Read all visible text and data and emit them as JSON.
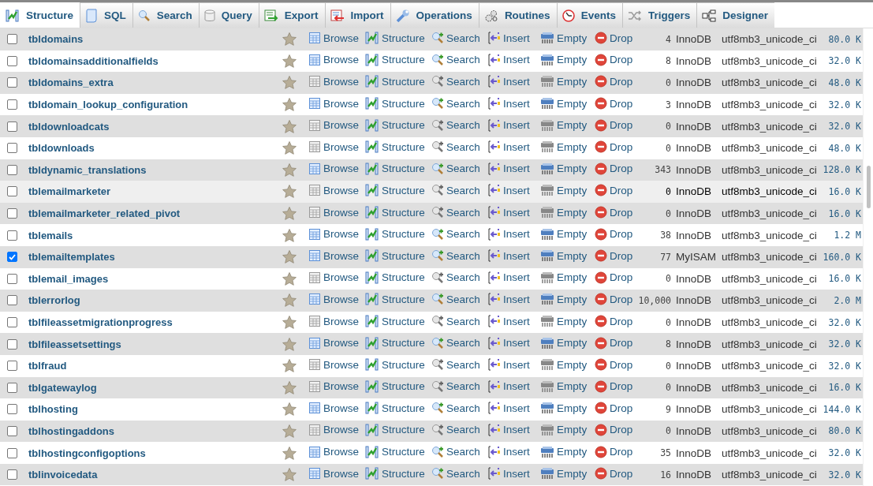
{
  "tabs": [
    {
      "label": "Structure",
      "selected": true
    },
    {
      "label": "SQL",
      "selected": false
    },
    {
      "label": "Search",
      "selected": false
    },
    {
      "label": "Query",
      "selected": false
    },
    {
      "label": "Export",
      "selected": false
    },
    {
      "label": "Import",
      "selected": false
    },
    {
      "label": "Operations",
      "selected": false
    },
    {
      "label": "Routines",
      "selected": false
    },
    {
      "label": "Events",
      "selected": false
    },
    {
      "label": "Triggers",
      "selected": false
    },
    {
      "label": "Designer",
      "selected": false
    }
  ],
  "rows": [
    {
      "name": "tbldomains",
      "checked": false,
      "hovered": false,
      "empty": false,
      "actions": [
        "Browse",
        "Structure",
        "Search",
        "Insert",
        "Empty",
        "Drop"
      ],
      "rows": "4",
      "engine": "InnoDB",
      "collation": "utf8mb3_unicode_ci",
      "size": "80.0 K"
    },
    {
      "name": "tbldomainsadditionalfields",
      "checked": false,
      "hovered": false,
      "empty": false,
      "actions": [
        "Browse",
        "Structure",
        "Search",
        "Insert",
        "Empty",
        "Drop"
      ],
      "rows": "8",
      "engine": "InnoDB",
      "collation": "utf8mb3_unicode_ci",
      "size": "32.0 K"
    },
    {
      "name": "tbldomains_extra",
      "checked": false,
      "hovered": false,
      "empty": true,
      "actions": [
        "Browse",
        "Structure",
        "Search",
        "Insert",
        "Empty",
        "Drop"
      ],
      "rows": "0",
      "engine": "InnoDB",
      "collation": "utf8mb3_unicode_ci",
      "size": "48.0 K"
    },
    {
      "name": "tbldomain_lookup_configuration",
      "checked": false,
      "hovered": false,
      "empty": false,
      "actions": [
        "Browse",
        "Structure",
        "Search",
        "Insert",
        "Empty",
        "Drop"
      ],
      "rows": "3",
      "engine": "InnoDB",
      "collation": "utf8mb3_unicode_ci",
      "size": "32.0 K"
    },
    {
      "name": "tbldownloadcats",
      "checked": false,
      "hovered": false,
      "empty": true,
      "actions": [
        "Browse",
        "Structure",
        "Search",
        "Insert",
        "Empty",
        "Drop"
      ],
      "rows": "0",
      "engine": "InnoDB",
      "collation": "utf8mb3_unicode_ci",
      "size": "32.0 K"
    },
    {
      "name": "tbldownloads",
      "checked": false,
      "hovered": false,
      "empty": true,
      "actions": [
        "Browse",
        "Structure",
        "Search",
        "Insert",
        "Empty",
        "Drop"
      ],
      "rows": "0",
      "engine": "InnoDB",
      "collation": "utf8mb3_unicode_ci",
      "size": "48.0 K"
    },
    {
      "name": "tbldynamic_translations",
      "checked": false,
      "hovered": false,
      "empty": false,
      "actions": [
        "Browse",
        "Structure",
        "Search",
        "Insert",
        "Empty",
        "Drop"
      ],
      "rows": "343",
      "engine": "InnoDB",
      "collation": "utf8mb3_unicode_ci",
      "size": "128.0 K"
    },
    {
      "name": "tblemailmarketer",
      "checked": false,
      "hovered": true,
      "empty": true,
      "actions": [
        "Browse",
        "Structure",
        "Search",
        "Insert",
        "Empty",
        "Drop"
      ],
      "rows": "0",
      "engine": "InnoDB",
      "collation": "utf8mb3_unicode_ci",
      "size": "16.0 K"
    },
    {
      "name": "tblemailmarketer_related_pivot",
      "checked": false,
      "hovered": false,
      "empty": true,
      "actions": [
        "Browse",
        "Structure",
        "Search",
        "Insert",
        "Empty",
        "Drop"
      ],
      "rows": "0",
      "engine": "InnoDB",
      "collation": "utf8mb3_unicode_ci",
      "size": "16.0 K"
    },
    {
      "name": "tblemails",
      "checked": false,
      "hovered": false,
      "empty": false,
      "actions": [
        "Browse",
        "Structure",
        "Search",
        "Insert",
        "Empty",
        "Drop"
      ],
      "rows": "38",
      "engine": "InnoDB",
      "collation": "utf8mb3_unicode_ci",
      "size": "1.2 M"
    },
    {
      "name": "tblemailtemplates",
      "checked": true,
      "hovered": false,
      "empty": false,
      "actions": [
        "Browse",
        "Structure",
        "Search",
        "Insert",
        "Empty",
        "Drop"
      ],
      "rows": "77",
      "engine": "MyISAM",
      "collation": "utf8mb3_unicode_ci",
      "size": "160.0 K"
    },
    {
      "name": "tblemail_images",
      "checked": false,
      "hovered": false,
      "empty": true,
      "actions": [
        "Browse",
        "Structure",
        "Search",
        "Insert",
        "Empty",
        "Drop"
      ],
      "rows": "0",
      "engine": "InnoDB",
      "collation": "utf8mb3_unicode_ci",
      "size": "16.0 K"
    },
    {
      "name": "tblerrorlog",
      "checked": false,
      "hovered": false,
      "empty": false,
      "actions": [
        "Browse",
        "Structure",
        "Search",
        "Insert",
        "Empty",
        "Drop"
      ],
      "rows": "10,000",
      "engine": "InnoDB",
      "collation": "utf8mb3_unicode_ci",
      "size": "2.0 M"
    },
    {
      "name": "tblfileassetmigrationprogress",
      "checked": false,
      "hovered": false,
      "empty": true,
      "actions": [
        "Browse",
        "Structure",
        "Search",
        "Insert",
        "Empty",
        "Drop"
      ],
      "rows": "0",
      "engine": "InnoDB",
      "collation": "utf8mb3_unicode_ci",
      "size": "32.0 K"
    },
    {
      "name": "tblfileassetsettings",
      "checked": false,
      "hovered": false,
      "empty": false,
      "actions": [
        "Browse",
        "Structure",
        "Search",
        "Insert",
        "Empty",
        "Drop"
      ],
      "rows": "8",
      "engine": "InnoDB",
      "collation": "utf8mb3_unicode_ci",
      "size": "32.0 K"
    },
    {
      "name": "tblfraud",
      "checked": false,
      "hovered": false,
      "empty": true,
      "actions": [
        "Browse",
        "Structure",
        "Search",
        "Insert",
        "Empty",
        "Drop"
      ],
      "rows": "0",
      "engine": "InnoDB",
      "collation": "utf8mb3_unicode_ci",
      "size": "32.0 K"
    },
    {
      "name": "tblgatewaylog",
      "checked": false,
      "hovered": false,
      "empty": true,
      "actions": [
        "Browse",
        "Structure",
        "Search",
        "Insert",
        "Empty",
        "Drop"
      ],
      "rows": "0",
      "engine": "InnoDB",
      "collation": "utf8mb3_unicode_ci",
      "size": "16.0 K"
    },
    {
      "name": "tblhosting",
      "checked": false,
      "hovered": false,
      "empty": false,
      "actions": [
        "Browse",
        "Structure",
        "Search",
        "Insert",
        "Empty",
        "Drop"
      ],
      "rows": "9",
      "engine": "InnoDB",
      "collation": "utf8mb3_unicode_ci",
      "size": "144.0 K"
    },
    {
      "name": "tblhostingaddons",
      "checked": false,
      "hovered": false,
      "empty": true,
      "actions": [
        "Browse",
        "Structure",
        "Search",
        "Insert",
        "Empty",
        "Drop"
      ],
      "rows": "0",
      "engine": "InnoDB",
      "collation": "utf8mb3_unicode_ci",
      "size": "80.0 K"
    },
    {
      "name": "tblhostingconfigoptions",
      "checked": false,
      "hovered": false,
      "empty": false,
      "actions": [
        "Browse",
        "Structure",
        "Search",
        "Insert",
        "Empty",
        "Drop"
      ],
      "rows": "35",
      "engine": "InnoDB",
      "collation": "utf8mb3_unicode_ci",
      "size": "32.0 K"
    },
    {
      "name": "tblinvoicedata",
      "checked": false,
      "hovered": false,
      "empty": false,
      "actions": [
        "Browse",
        "Structure",
        "Search",
        "Insert",
        "Empty",
        "Drop"
      ],
      "rows": "16",
      "engine": "InnoDB",
      "collation": "utf8mb3_unicode_ci",
      "size": "32.0 K"
    }
  ]
}
